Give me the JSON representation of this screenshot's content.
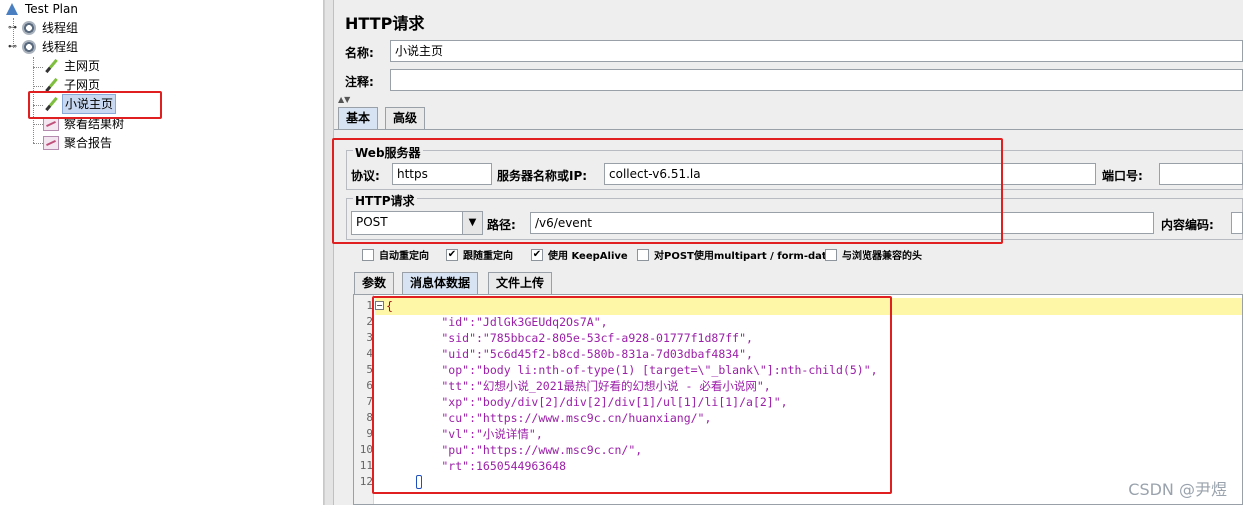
{
  "tree": {
    "items": [
      {
        "label": "Test Plan",
        "icon": "test-plan-icon"
      },
      {
        "label": "线程组",
        "icon": "thread-group-icon"
      },
      {
        "label": "线程组",
        "icon": "thread-group-icon"
      },
      {
        "label": "主网页",
        "icon": "http-sampler-icon"
      },
      {
        "label": "子网页",
        "icon": "http-sampler-icon"
      },
      {
        "label": "小说主页",
        "icon": "http-sampler-icon"
      },
      {
        "label": "察看结果树",
        "icon": "listener-icon"
      },
      {
        "label": "聚合报告",
        "icon": "listener-icon"
      }
    ]
  },
  "panel": {
    "title": "HTTP请求",
    "name_label": "名称:",
    "name_value": "小说主页",
    "comment_label": "注释:",
    "comment_value": "",
    "tabs": [
      "基本",
      "高级"
    ]
  },
  "web_server": {
    "title": "Web服务器",
    "protocol_label": "协议:",
    "protocol_value": "https",
    "server_label": "服务器名称或IP:",
    "server_value": "collect-v6.51.la",
    "port_label": "端口号:",
    "port_value": ""
  },
  "http_request": {
    "title": "HTTP请求",
    "method": "POST",
    "path_label": "路径:",
    "path_value": "/v6/event",
    "encoding_label": "内容编码:",
    "encoding_value": ""
  },
  "options": [
    {
      "label": "自动重定向",
      "checked": false
    },
    {
      "label": "跟随重定向",
      "checked": true
    },
    {
      "label": "使用 KeepAlive",
      "checked": true
    },
    {
      "label": "对POST使用multipart / form-data",
      "checked": false
    },
    {
      "label": "与浏览器兼容的头",
      "checked": false
    }
  ],
  "sub_tabs": [
    "参数",
    "消息体数据",
    "文件上传"
  ],
  "body_lines": [
    "{",
    "        \"id\":\"JdlGk3GEUdq2Os7A\",",
    "        \"sid\":\"785bbca2-805e-53cf-a928-01777f1d87ff\",",
    "        \"uid\":\"5c6d45f2-b8cd-580b-831a-7d03dbaf4834\",",
    "        \"op\":\"body li:nth-of-type(1) [target=\\\"_blank\\\"]:nth-child(5)\",",
    "        \"tt\":\"幻想小说_2021最热门好看的幻想小说 - 必看小说网\",",
    "        \"xp\":\"body/div[2]/div[2]/div[1]/ul[1]/li[1]/a[2]\",",
    "        \"cu\":\"https://www.msc9c.cn/huanxiang/\",",
    "        \"vl\":\"小说详情\",",
    "        \"pu\":\"https://www.msc9c.cn/\",",
    "        \"rt\":1650544963648",
    ""
  ],
  "line_numbers": [
    "1",
    "2",
    "3",
    "4",
    "5",
    "6",
    "7",
    "8",
    "9",
    "10",
    "11",
    "12"
  ],
  "watermark": "CSDN @尹煜",
  "colors": {
    "highlight_box": "#e02020",
    "selected_row": "#c7d8f0",
    "code_text": "#9b1fa8"
  }
}
